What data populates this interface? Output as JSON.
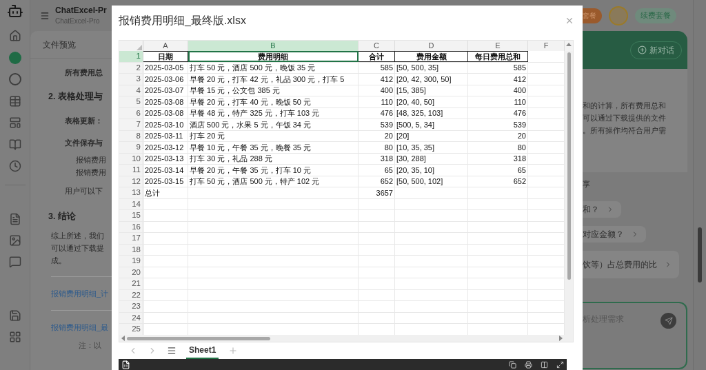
{
  "app": {
    "title": "ChatExcel-Pr",
    "subtitle": "ChatExcel-Pro",
    "plan_button": "套餐",
    "renew_button": "续费套餐",
    "new_chat_button": "新对话"
  },
  "sidebar": {
    "items": [
      {
        "kind": "home"
      },
      {
        "kind": "pro",
        "selected": true
      },
      {
        "kind": "max",
        "selected": false
      },
      {
        "kind": "table"
      },
      {
        "kind": "layout"
      },
      {
        "kind": "book"
      },
      {
        "kind": "history"
      },
      {
        "kind": "pdf"
      },
      {
        "kind": "image"
      },
      {
        "kind": "chat"
      },
      {
        "kind": "save"
      },
      {
        "kind": "apps"
      }
    ]
  },
  "left_panel": {
    "tabs": [
      {
        "label": "文件预览",
        "selected": false
      }
    ],
    "content": [
      {
        "kind": "bold",
        "text": "所有费用总"
      },
      {
        "kind": "heading",
        "text": "2. 表格处理与"
      },
      {
        "kind": "bold",
        "text": "表格更新："
      },
      {
        "kind": "bold",
        "text": "文件保存与"
      },
      {
        "kind": "sub",
        "text": "报销费用"
      },
      {
        "kind": "sub",
        "text": "报销费用"
      },
      {
        "kind": "indent",
        "text": "用户可以下"
      },
      {
        "kind": "heading",
        "text": "3. 结论"
      },
      {
        "kind": "para",
        "text": "综上所述，我们"
      },
      {
        "kind": "para",
        "text": "可以通过下载提"
      },
      {
        "kind": "para",
        "text": "成。"
      },
      {
        "kind": "rule"
      },
      {
        "kind": "link",
        "text": "报销费用明细_计"
      },
      {
        "kind": "rule"
      },
      {
        "kind": "link",
        "text": "报销费用明细_最"
      },
      {
        "kind": "note",
        "text": "注：以"
      }
    ]
  },
  "right_panel": {
    "answer_lines": [
      "和的计算，所有费用总和",
      "可以通过下载提供的文件",
      "。所有操作均符合用户需"
    ],
    "answer_tail": "享",
    "suggestions": [
      "和？",
      "对应金额？",
      "饮等）占总费用的比"
    ],
    "input": {
      "placeholder": "析处理需求"
    }
  },
  "modal": {
    "title": "报销费用明细_最终版.xlsx",
    "columns": [
      {
        "letter": "A",
        "kind": "text",
        "selected": false
      },
      {
        "letter": "B",
        "kind": "text",
        "selected": true
      },
      {
        "letter": "C",
        "kind": "number",
        "selected": false
      },
      {
        "letter": "D",
        "kind": "text",
        "selected": false
      },
      {
        "letter": "E",
        "kind": "number",
        "selected": false
      },
      {
        "letter": "F",
        "kind": "text",
        "selected": false
      }
    ],
    "rows": [
      {
        "number": "1",
        "kind": "header",
        "selected": true,
        "cells": {
          "A": "日期",
          "B": "费用明细",
          "C": "合计",
          "D": "费用金额",
          "E": "每日费用总和"
        }
      },
      {
        "number": "2",
        "kind": "data",
        "selected": false,
        "cells": {
          "A": "2025-03-05",
          "B": "打车 50 元，酒店 500 元，晚饭 35 元",
          "C": "585",
          "D": "[50, 500, 35]",
          "E": "585"
        }
      },
      {
        "number": "3",
        "kind": "data",
        "selected": false,
        "cells": {
          "A": "2025-03-06",
          "B": "早餐 20 元，打车 42 元，礼品 300 元，打车 5",
          "C": "412",
          "D": "[20, 42, 300, 50]",
          "E": "412"
        }
      },
      {
        "number": "4",
        "kind": "data",
        "selected": false,
        "cells": {
          "A": "2025-03-07",
          "B": "早餐 15 元，公文包 385 元",
          "C": "400",
          "D": "[15, 385]",
          "E": "400"
        }
      },
      {
        "number": "5",
        "kind": "data",
        "selected": false,
        "cells": {
          "A": "2025-03-08",
          "B": "早餐 20 元，打车 40 元，晚饭 50 元",
          "C": "110",
          "D": "[20, 40, 50]",
          "E": "110"
        }
      },
      {
        "number": "6",
        "kind": "data",
        "selected": false,
        "cells": {
          "A": "2025-03-08",
          "B": "早餐 48 元，特产 325 元，打车 103 元",
          "C": "476",
          "D": "[48, 325, 103]",
          "E": "476"
        }
      },
      {
        "number": "7",
        "kind": "data",
        "selected": false,
        "cells": {
          "A": "2025-03-10",
          "B": "酒店 500 元，水果 5 元，午饭 34 元",
          "C": "539",
          "D": "[500, 5, 34]",
          "E": "539"
        }
      },
      {
        "number": "8",
        "kind": "data",
        "selected": false,
        "cells": {
          "A": "2025-03-11",
          "B": "打车 20 元",
          "C": "20",
          "D": "[20]",
          "E": "20"
        }
      },
      {
        "number": "9",
        "kind": "data",
        "selected": false,
        "cells": {
          "A": "2025-03-12",
          "B": "早餐 10 元，午餐 35 元，晚餐 35 元",
          "C": "80",
          "D": "[10, 35, 35]",
          "E": "80"
        }
      },
      {
        "number": "10",
        "kind": "data",
        "selected": false,
        "cells": {
          "A": "2025-03-13",
          "B": "打车 30 元，礼品 288 元",
          "C": "318",
          "D": "[30, 288]",
          "E": "318"
        }
      },
      {
        "number": "11",
        "kind": "data",
        "selected": false,
        "cells": {
          "A": "2025-03-14",
          "B": "早餐 20 元，午餐 35 元，打车 10 元",
          "C": "65",
          "D": "[20, 35, 10]",
          "E": "65"
        }
      },
      {
        "number": "12",
        "kind": "data",
        "selected": false,
        "cells": {
          "A": "2025-03-15",
          "B": "打车 50 元，酒店 500 元，特产 102 元",
          "C": "652",
          "D": "[50, 500, 102]",
          "E": "652"
        }
      },
      {
        "number": "13",
        "kind": "data",
        "selected": false,
        "cells": {
          "A": "总计",
          "C": "3657"
        }
      },
      {
        "number": "14",
        "kind": "data",
        "selected": false,
        "cells": {}
      },
      {
        "number": "15",
        "kind": "data",
        "selected": false,
        "cells": {}
      },
      {
        "number": "16",
        "kind": "data",
        "selected": false,
        "cells": {}
      },
      {
        "number": "17",
        "kind": "data",
        "selected": false,
        "cells": {}
      },
      {
        "number": "18",
        "kind": "data",
        "selected": false,
        "cells": {}
      },
      {
        "number": "19",
        "kind": "data",
        "selected": false,
        "cells": {}
      },
      {
        "number": "20",
        "kind": "data",
        "selected": false,
        "cells": {}
      },
      {
        "number": "21",
        "kind": "data",
        "selected": false,
        "cells": {}
      },
      {
        "number": "22",
        "kind": "data",
        "selected": false,
        "cells": {}
      },
      {
        "number": "23",
        "kind": "data",
        "selected": false,
        "cells": {}
      },
      {
        "number": "24",
        "kind": "data",
        "selected": false,
        "cells": {}
      },
      {
        "number": "25",
        "kind": "data",
        "selected": false,
        "cells": {}
      }
    ],
    "sheets": [
      {
        "label": "Sheet1",
        "selected": true
      }
    ]
  }
}
